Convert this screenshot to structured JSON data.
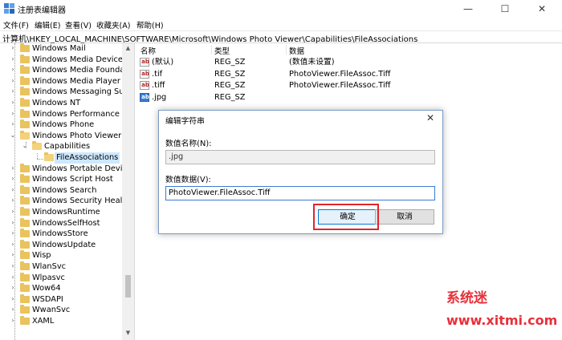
{
  "window": {
    "title": "注册表编辑器",
    "minimize": "—",
    "maximize": "☐",
    "close": "✕"
  },
  "menu": [
    "文件(F)",
    "编辑(E)",
    "查看(V)",
    "收藏夹(A)",
    "帮助(H)"
  ],
  "address": "计算机\\HKEY_LOCAL_MACHINE\\SOFTWARE\\Microsoft\\Windows Photo Viewer\\Capabilities\\FileAssociations",
  "tree": [
    {
      "label": "Windows Mail",
      "expander": "›"
    },
    {
      "label": "Windows Media Device M",
      "expander": "›"
    },
    {
      "label": "Windows Media Foundati",
      "expander": "›"
    },
    {
      "label": "Windows Media Player N",
      "expander": "›"
    },
    {
      "label": "Windows Messaging Sub",
      "expander": "›"
    },
    {
      "label": "Windows NT",
      "expander": "›"
    },
    {
      "label": "Windows Performance To",
      "expander": "›"
    },
    {
      "label": "Windows Phone",
      "expander": "›"
    },
    {
      "label": "Windows Photo Viewer",
      "expander": "⌄"
    },
    {
      "label": "Capabilities",
      "expander": "⌄"
    },
    {
      "label": "FileAssociations",
      "expander": ""
    },
    {
      "label": "Windows Portable Device",
      "expander": "›"
    },
    {
      "label": "Windows Script Host",
      "expander": "›"
    },
    {
      "label": "Windows Search",
      "expander": "›"
    },
    {
      "label": "Windows Security Health",
      "expander": "›"
    },
    {
      "label": "WindowsRuntime",
      "expander": "›"
    },
    {
      "label": "WindowsSelfHost",
      "expander": "›"
    },
    {
      "label": "WindowsStore",
      "expander": "›"
    },
    {
      "label": "WindowsUpdate",
      "expander": "›"
    },
    {
      "label": "Wisp",
      "expander": "›"
    },
    {
      "label": "WlanSvc",
      "expander": "›"
    },
    {
      "label": "Wlpasvc",
      "expander": "›"
    },
    {
      "label": "Wow64",
      "expander": "›"
    },
    {
      "label": "WSDAPI",
      "expander": "›"
    },
    {
      "label": "WwanSvc",
      "expander": "›"
    },
    {
      "label": "XAML",
      "expander": "›"
    }
  ],
  "columns": {
    "name": "名称",
    "type": "类型",
    "data": "数据"
  },
  "values": [
    {
      "name": "(默认)",
      "type": "REG_SZ",
      "data": "(数值未设置)",
      "icon": "ab"
    },
    {
      "name": ".tif",
      "type": "REG_SZ",
      "data": "PhotoViewer.FileAssoc.Tiff",
      "icon": "ab"
    },
    {
      "name": ".tiff",
      "type": "REG_SZ",
      "data": "PhotoViewer.FileAssoc.Tiff",
      "icon": "ab"
    },
    {
      "name": ".jpg",
      "type": "REG_SZ",
      "data": "",
      "icon": "ab"
    }
  ],
  "dialog": {
    "title": "编辑字符串",
    "close": "✕",
    "name_label": "数值名称(N):",
    "name_value": ".jpg",
    "data_label": "数值数据(V):",
    "data_value": "PhotoViewer.FileAssoc.Tiff",
    "ok": "确定",
    "cancel": "取消"
  },
  "watermark": {
    "text": "系统迷",
    "url": "www.xitmi.com"
  },
  "colors": {
    "accent": "#0078d7",
    "highlight": "#e0262b",
    "watermark": "#e8303a"
  }
}
